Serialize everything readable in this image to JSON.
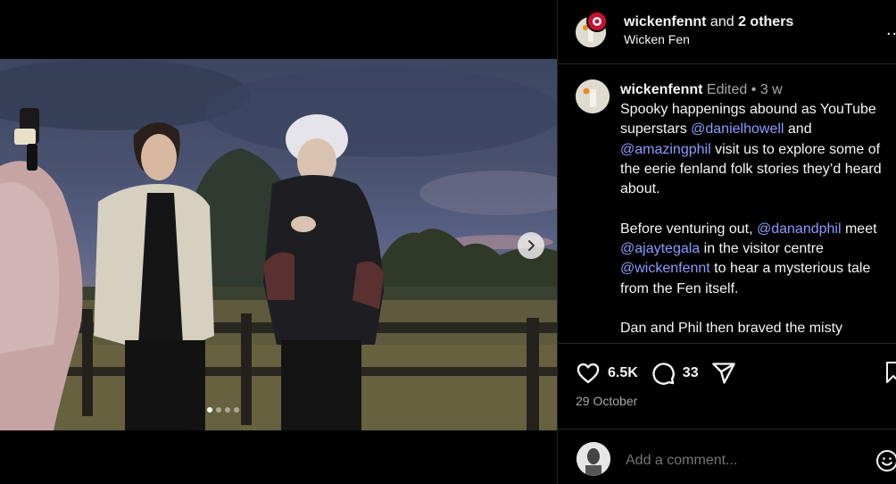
{
  "post": {
    "media": {
      "slide_count": 4,
      "active_slide": 1
    },
    "header": {
      "username": "wickenfennt",
      "collab_text": "and",
      "others": "2 others",
      "location": "Wicken Fen",
      "more_label": "..."
    },
    "caption": {
      "username": "wickenfennt",
      "edited": "Edited",
      "separator": "•",
      "age": "3 w",
      "p1": {
        "t1": "Spooky happenings abound as YouTube superstars ",
        "m1": "@danielhowell",
        "t2": " and ",
        "m2": "@amazingphil",
        "t3": " visit us to explore some of the eerie fenland folk stories they’d heard about."
      },
      "p2": {
        "t1": "Before venturing out, ",
        "m1": "@danandphil",
        "t2": " meet ",
        "m2": "@ajaytegala",
        "t3": " in the visitor centre ",
        "m3": "@wickenfennt",
        "t4": " to hear a mysterious tale from the Fen itself."
      },
      "p3": {
        "t1": "Dan and Phil then braved the misty"
      }
    },
    "stats": {
      "likes": "6.5K",
      "comments": "33"
    },
    "date": "29 October",
    "comment_box": {
      "placeholder": "Add a comment..."
    }
  },
  "icons": {
    "like": "heart-icon",
    "comment": "comment-bubble-icon",
    "share": "paper-plane-icon",
    "save": "bookmark-icon",
    "emoji": "smiley-icon",
    "next": "chevron-right-icon"
  },
  "colors": {
    "background": "#000000",
    "mention": "#8c9bff",
    "secondary_text": "#a8a8a8",
    "divider": "#262626"
  }
}
